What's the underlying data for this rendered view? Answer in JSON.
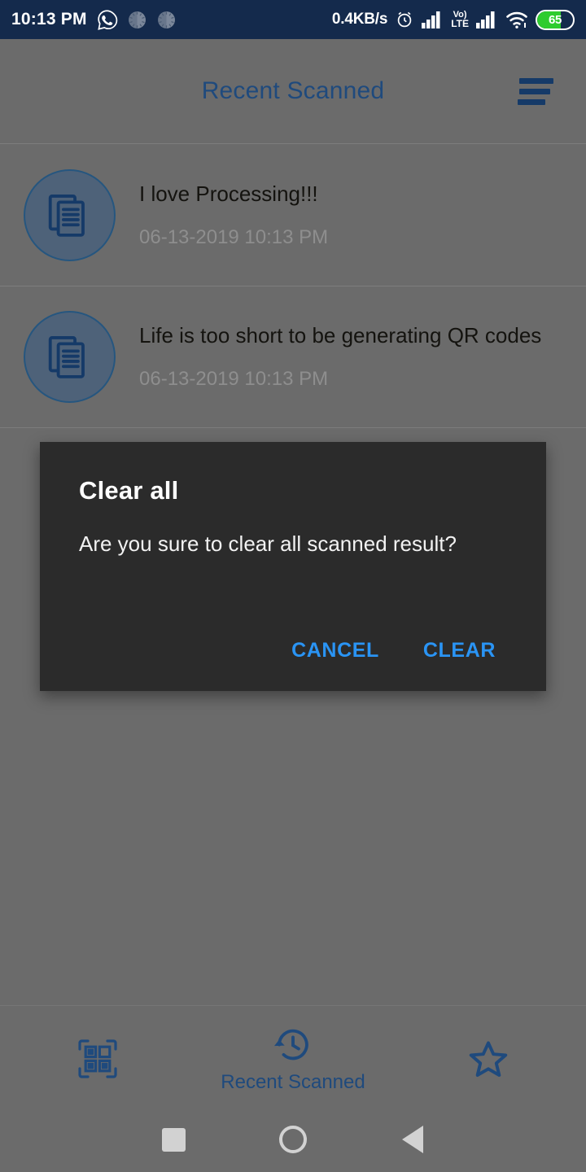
{
  "status_bar": {
    "time": "10:13 PM",
    "network_speed": "0.4KB/s",
    "volte_top": "Vo)",
    "volte_bottom": "LTE",
    "battery_percent": "65",
    "battery_level": 65,
    "background_color": "#142a4c",
    "icons": [
      "whatsapp-icon",
      "notification-circle-icon",
      "notification-circle-icon",
      "alarm-icon",
      "signal-bars-icon",
      "volte-icon",
      "signal-bars-icon",
      "wifi-icon",
      "battery-icon"
    ]
  },
  "appbar": {
    "title": "Recent Scanned",
    "title_color": "#1f4a7d",
    "sort_icon": "sort-icon"
  },
  "list": {
    "items": [
      {
        "icon": "documents-icon",
        "title": "I love Processing!!!",
        "timestamp": "06-13-2019 10:13 PM"
      },
      {
        "icon": "documents-icon",
        "title": "Life is too short to be generating QR codes",
        "timestamp": "06-13-2019 10:13 PM"
      }
    ]
  },
  "dialog": {
    "title": "Clear all",
    "message": "Are you sure to clear all scanned result?",
    "cancel_label": "CANCEL",
    "confirm_label": "CLEAR",
    "background_color": "#2b2b2b",
    "button_color": "#2a94f4"
  },
  "bottom_nav": {
    "items": [
      {
        "icon": "qr-scan-icon",
        "label": "",
        "selected": false
      },
      {
        "icon": "history-icon",
        "label": "Recent Scanned",
        "selected": true
      },
      {
        "icon": "star-icon",
        "label": "",
        "selected": false
      }
    ],
    "accent_color": "#1f4a7d"
  },
  "system_nav": {
    "recents": "recents-square-icon",
    "home": "home-circle-icon",
    "back": "back-triangle-icon"
  }
}
